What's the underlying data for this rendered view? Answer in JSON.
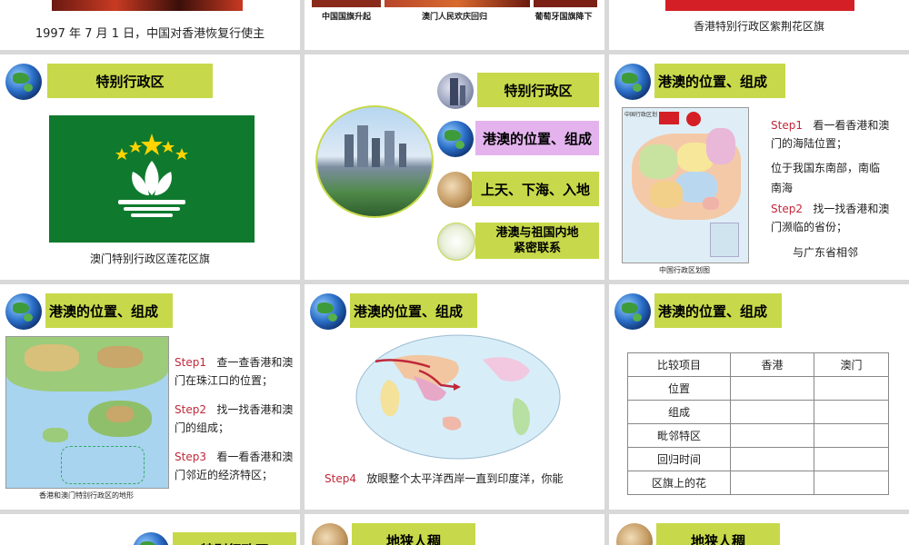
{
  "slide_top_left": {
    "caption": "1997 年 7 月 1 日，中国对香港恢复行使主"
  },
  "slide_top_mid": {
    "captions": [
      "中国国旗升起",
      "澳门人民欢庆回归",
      "葡萄牙国旗降下"
    ]
  },
  "slide_top_right": {
    "caption": "香港特别行政区紫荆花区旗"
  },
  "slide_macao_flag": {
    "title": "特别行政区",
    "caption": "澳门特别行政区莲花区旗"
  },
  "slide_menu": {
    "items": [
      "特别行政区",
      "港澳的位置、组成",
      "上天、下海、入地",
      "港澳与祖国内地\n紧密联系"
    ]
  },
  "slide_china_map": {
    "title": "港澳的位置、组成",
    "map_caption": "中国行政区划图",
    "map_header": "中国行政区划",
    "step1_label": "Step1",
    "step1_text": "看一看香港和澳门的海陆位置；",
    "answer1": "位于我国东南部，南临南海",
    "step2_label": "Step2",
    "step2_text": "找一找香港和澳门濒临的省份；",
    "answer2": "与广东省相邻"
  },
  "slide_terrain": {
    "title": "港澳的位置、组成",
    "map_caption": "香港和澳门特别行政区的地形",
    "step1_label": "Step1",
    "step1_text": "查一查香港和澳门在珠江口的位置；",
    "step2_label": "Step2",
    "step2_text": "找一找香港和澳门的组成；",
    "step3_label": "Step3",
    "step3_text": "看一看香港和澳门邻近的经济特区；"
  },
  "slide_world": {
    "title": "港澳的位置、组成",
    "step4_label": "Step4",
    "step4_text": "放眼整个太平洋西岸一直到印度洋，你能"
  },
  "slide_table": {
    "title": "港澳的位置、组成",
    "headers": [
      "比较项目",
      "香港",
      "澳门"
    ],
    "rows": [
      "位置",
      "组成",
      "毗邻特区",
      "回归时间",
      "区旗上的花"
    ]
  },
  "slide_bottom_left": {
    "title": "特别行政区"
  },
  "slide_bottom_mid": {
    "title": "地狭人稠"
  },
  "slide_bottom_right": {
    "title": "地狭人稠"
  },
  "colors": {
    "title_bg": "#c7d94a",
    "step_red": "#c0283a",
    "macao_green": "#0f7a2e",
    "menu_pink": "#e4b3ee"
  }
}
